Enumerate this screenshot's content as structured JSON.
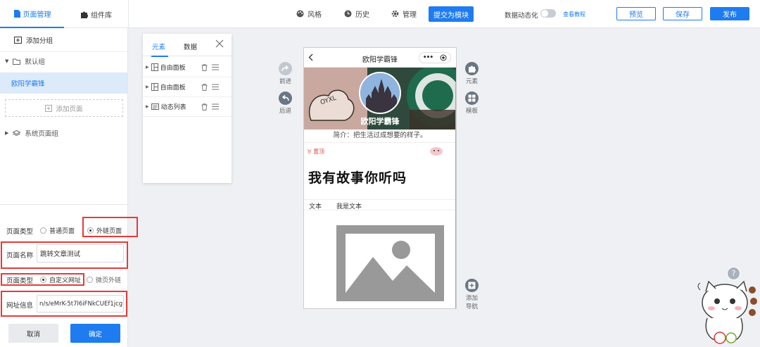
{
  "topbar": {
    "tab_pages": "页面管理",
    "tab_components": "组件库",
    "style": "风格",
    "history": "历史",
    "manage": "管理",
    "submit_module": "提交为模块",
    "data_dynamic": "数据动态化",
    "view_tutorial": "查看教程",
    "preview": "预览",
    "save": "保存",
    "publish": "发布"
  },
  "leftpanel": {
    "add_group": "添加分组",
    "default_group": "默认组",
    "selected_page": "欧阳学霸锋",
    "add_page": "添加页面",
    "system_group": "系统页面组",
    "page_type_label": "页面类型",
    "page_type_options": [
      "普通页面",
      "外链页面"
    ],
    "page_name_label": "页面名称",
    "page_name_value": "跳转文章测试",
    "link_type_label": "页面类型",
    "link_type_options": [
      "自定义网址",
      "微页外链"
    ],
    "url_label": "网址信息",
    "url_value": "n/s/eMrK-5t7l6iFNkCUEf1jcg",
    "cancel": "取消",
    "confirm": "确定"
  },
  "elements_panel": {
    "tab_elements": "元素",
    "tab_data": "数据",
    "items": [
      "自由面板",
      "自由面板",
      "动态列表"
    ]
  },
  "canvas_tools": {
    "forward": "前进",
    "back": "后退",
    "element": "元素",
    "template": "模板",
    "add_nav_line1": "添加",
    "add_nav_line2": "导航"
  },
  "phone": {
    "title": "欧阳学霸锋",
    "profile_name": "欧阳学霸锋",
    "avatar_text": "OYXL",
    "bio": "简介：把生活过成想要的样子。",
    "pin_tag": "置顶",
    "banner_text": "我有故事你听吗",
    "text_label": "文本",
    "text_value": "我是文本"
  },
  "colors": {
    "primary": "#1e7cf0",
    "highlight_red": "#e43b3b",
    "selected_bg": "#ddeaf9"
  }
}
